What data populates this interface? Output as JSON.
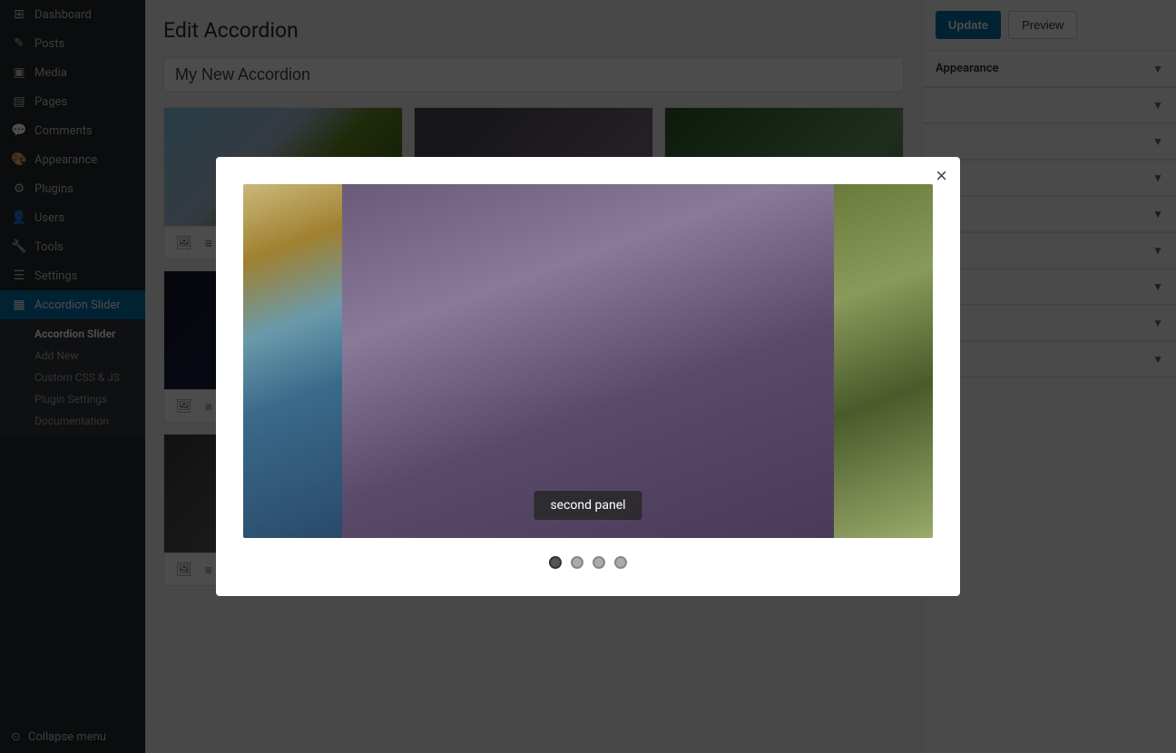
{
  "sidebar": {
    "items": [
      {
        "id": "dashboard",
        "label": "Dashboard",
        "icon": "⊞"
      },
      {
        "id": "posts",
        "label": "Posts",
        "icon": "✎"
      },
      {
        "id": "media",
        "label": "Media",
        "icon": "▣"
      },
      {
        "id": "pages",
        "label": "Pages",
        "icon": "▤"
      },
      {
        "id": "comments",
        "label": "Comments",
        "icon": "💬"
      },
      {
        "id": "appearance",
        "label": "Appearance",
        "icon": "🎨"
      },
      {
        "id": "plugins",
        "label": "Plugins",
        "icon": "⚙"
      },
      {
        "id": "users",
        "label": "Users",
        "icon": "👤"
      },
      {
        "id": "tools",
        "label": "Tools",
        "icon": "🔧"
      },
      {
        "id": "settings",
        "label": "Settings",
        "icon": "☰"
      }
    ],
    "active_item": "accordion-slider",
    "accordion_slider_section": {
      "label": "Accordion Slider",
      "sub_items": [
        {
          "id": "accordion-slider",
          "label": "Accordion Slider"
        },
        {
          "id": "add-new",
          "label": "Add New"
        },
        {
          "id": "custom-css-js",
          "label": "Custom CSS & JS"
        },
        {
          "id": "plugin-settings",
          "label": "Plugin Settings"
        },
        {
          "id": "documentation",
          "label": "Documentation"
        }
      ]
    },
    "collapse_label": "Collapse menu"
  },
  "page": {
    "title": "Edit Accordion",
    "accordion_title": "My New Accordion"
  },
  "toolbar": {
    "update_label": "Update",
    "preview_label": "Preview"
  },
  "right_panel": {
    "sections": [
      {
        "label": "Appearance"
      },
      {
        "label": ""
      },
      {
        "label": ""
      },
      {
        "label": ""
      },
      {
        "label": ""
      },
      {
        "label": ""
      },
      {
        "label": ""
      },
      {
        "label": ""
      },
      {
        "label": ""
      }
    ]
  },
  "modal": {
    "panels": [
      {
        "id": "panel-1",
        "label": ""
      },
      {
        "id": "panel-2",
        "label": "second panel"
      },
      {
        "id": "panel-3",
        "label": ""
      }
    ],
    "dots": [
      {
        "active": true
      },
      {
        "active": false
      },
      {
        "active": false
      },
      {
        "active": false
      }
    ],
    "close_label": "×"
  },
  "slides": [
    {
      "id": 1,
      "thumb_class": "thumb-1"
    },
    {
      "id": 2,
      "thumb_class": "thumb-2"
    },
    {
      "id": 3,
      "thumb_class": "thumb-3"
    },
    {
      "id": 4,
      "thumb_class": "thumb-4"
    },
    {
      "id": 5,
      "thumb_class": "thumb-5"
    },
    {
      "id": 6,
      "thumb_class": "thumb-6"
    },
    {
      "id": 7,
      "thumb_class": "thumb-7"
    },
    {
      "id": 8,
      "thumb_class": "thumb-8"
    },
    {
      "id": 9,
      "thumb_class": "thumb-9"
    }
  ]
}
